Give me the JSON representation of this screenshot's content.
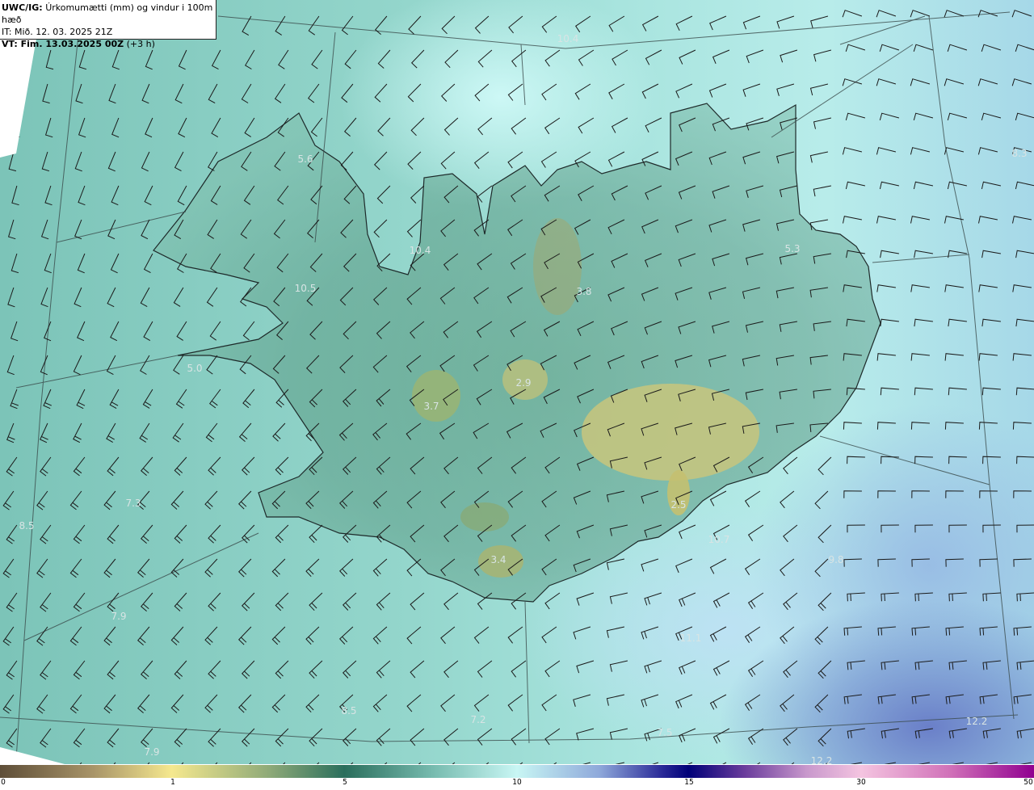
{
  "title": {
    "model": "UWC/IG:",
    "description": "Úrkomumætti (mm) og vindur i 100m hæð",
    "issue_time": "IT: Mið. 12. 03. 2025 21Z",
    "valid_label": "VT: Fim. 13.03.2025 00Z",
    "valid_offset": "(+3 h)"
  },
  "map_labels": [
    "10.4",
    "8.3",
    "5.6",
    "5.3",
    "10.4",
    "10.5",
    "3.8",
    "5.0",
    "2.9",
    "3.7",
    "7.3",
    "8.5",
    "2.5",
    "10.7",
    "9.8",
    "3.4",
    "7.9",
    "11.1",
    "8.5",
    "7.2",
    "7.5",
    "12.2",
    "7.9",
    "12.2"
  ],
  "colorbar": {
    "ticks": [
      "0",
      "1",
      "5",
      "10",
      "15",
      "30",
      "50"
    ],
    "colors": {
      "0": "#5e4e38",
      "1": "#f5e88e",
      "5": "#2a6e5c",
      "10": "#c8f6f4",
      "15": "#000078",
      "30": "#f4c4e0",
      "50": "#900090"
    }
  }
}
